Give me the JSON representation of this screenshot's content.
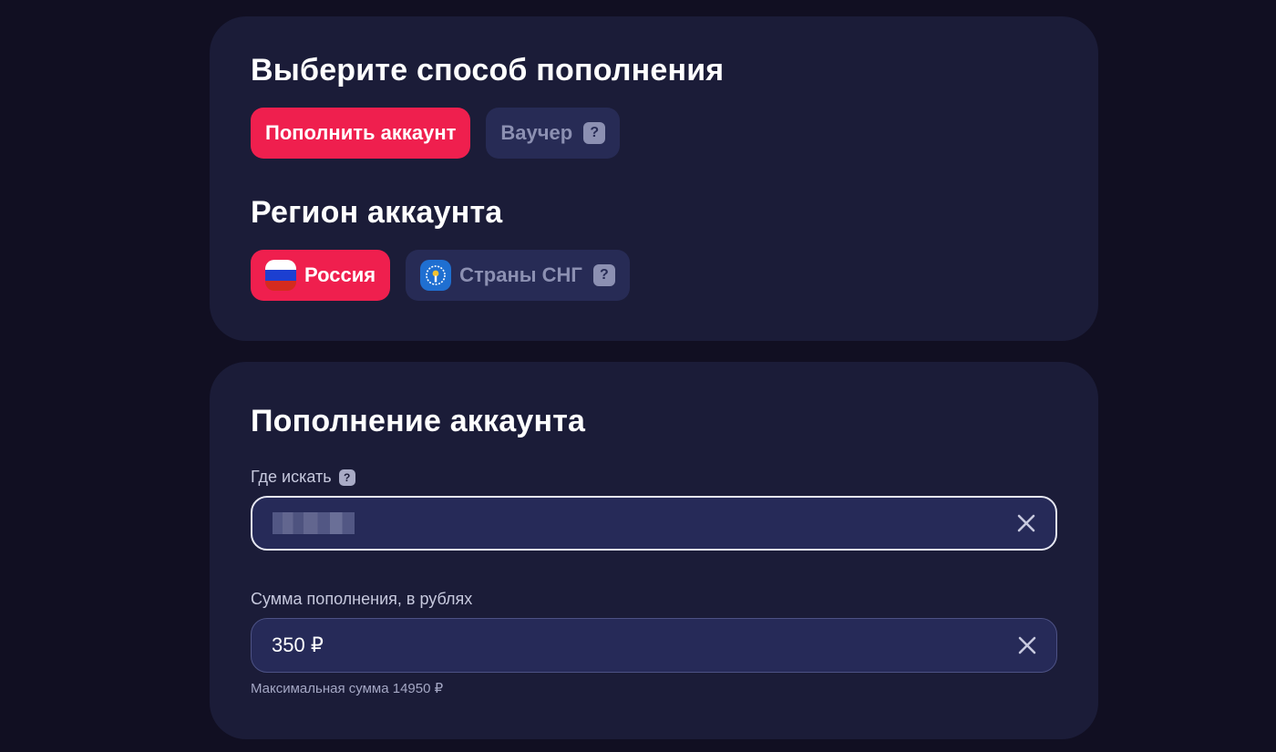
{
  "method_section": {
    "title": "Выберите способ пополнения",
    "options": [
      {
        "label": "Пополнить аккаунт",
        "active": true
      },
      {
        "label": "Ваучер",
        "active": false,
        "icon": "question-icon"
      }
    ]
  },
  "region_section": {
    "title": "Регион аккаунта",
    "options": [
      {
        "label": "Россия",
        "active": true,
        "icon": "russia-flag-icon"
      },
      {
        "label": "Страны СНГ",
        "active": false,
        "icon": "cis-emblem-icon"
      }
    ]
  },
  "topup_section": {
    "title": "Пополнение аккаунта",
    "where_field": {
      "label": "Где искать",
      "value_redacted": true,
      "icon": "close-icon"
    },
    "sum_field": {
      "label": "Сумма пополнения, в рублях",
      "value": "350 ₽",
      "icon": "close-icon"
    },
    "hint": "Максимальная сумма 14950 ₽"
  },
  "colors": {
    "background": "#110f22",
    "card": "#1b1c38",
    "accent": "#ef1f4e",
    "inactive_pill": "#272b55",
    "input": "#262a58"
  }
}
